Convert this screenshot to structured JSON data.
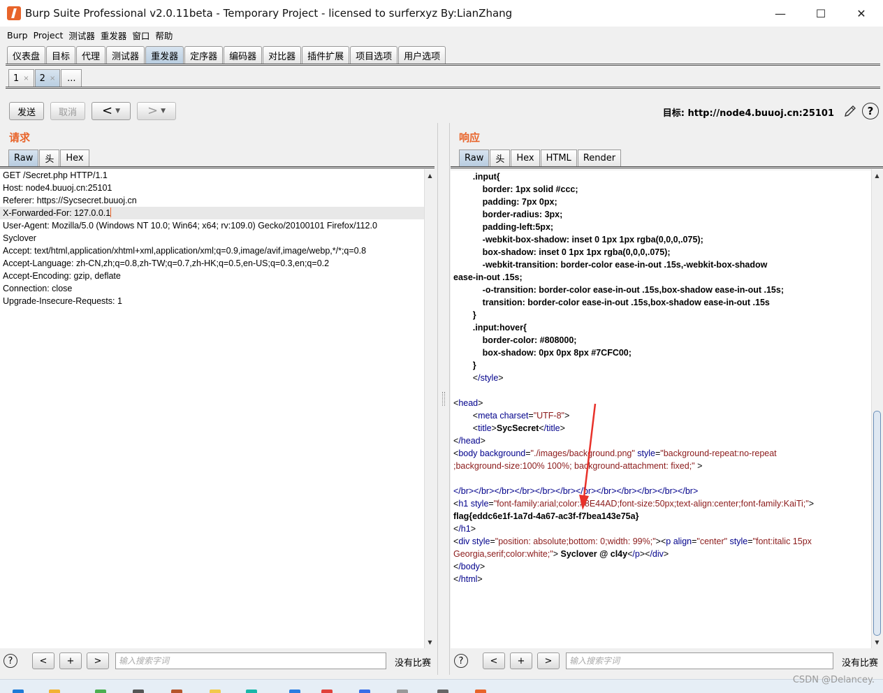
{
  "window": {
    "title": "Burp Suite Professional v2.0.11beta - Temporary Project - licensed to surferxyz By:LianZhang",
    "minimize": "—",
    "maximize": "☐",
    "close": "✕"
  },
  "menu": [
    "Burp",
    "Project",
    "测试器",
    "重发器",
    "窗口",
    "帮助"
  ],
  "main_tabs": [
    {
      "label": "仪表盘",
      "active": false
    },
    {
      "label": "目标",
      "active": false
    },
    {
      "label": "代理",
      "active": false
    },
    {
      "label": "测试器",
      "active": false
    },
    {
      "label": "重发器",
      "active": true
    },
    {
      "label": "定序器",
      "active": false
    },
    {
      "label": "编码器",
      "active": false
    },
    {
      "label": "对比器",
      "active": false
    },
    {
      "label": "插件扩展",
      "active": false
    },
    {
      "label": "项目选项",
      "active": false
    },
    {
      "label": "用户选项",
      "active": false
    }
  ],
  "repeater_tabs": {
    "tab1": "1",
    "tab2": "2",
    "close": "×",
    "more": "..."
  },
  "toolbar": {
    "send": "发送",
    "cancel": "取消",
    "back": "<",
    "forward": ">",
    "dropdown": "▼",
    "target_label": "目标: http://node4.buuoj.cn:25101"
  },
  "request": {
    "title": "请求",
    "tabs": [
      "Raw",
      "头",
      "Hex"
    ],
    "lines": [
      "GET /Secret.php HTTP/1.1",
      "Host: node4.buuoj.cn:25101",
      "Referer: https://Sycsecret.buuoj.cn",
      "X-Forwarded-For: 127.0.0.1",
      "User-Agent: Mozilla/5.0 (Windows NT 10.0; Win64; x64; rv:109.0) Gecko/20100101 Firefox/112.0",
      "Syclover",
      "Accept: text/html,application/xhtml+xml,application/xml;q=0.9,image/avif,image/webp,*/*;q=0.8",
      "Accept-Language: zh-CN,zh;q=0.8,zh-TW;q=0.7,zh-HK;q=0.5,en-US;q=0.3,en;q=0.2",
      "Accept-Encoding: gzip, deflate",
      "Connection: close",
      "Upgrade-Insecure-Requests: 1"
    ]
  },
  "response": {
    "title": "响应",
    "tabs": [
      "Raw",
      "头",
      "Hex",
      "HTML",
      "Render"
    ],
    "css_lines": [
      "        .input{",
      "            border: 1px solid #ccc;",
      "            padding: 7px 0px;",
      "            border-radius: 3px;",
      "            padding-left:5px;",
      "            -webkit-box-shadow: inset 0 1px 1px rgba(0,0,0,.075);",
      "            box-shadow: inset 0 1px 1px rgba(0,0,0,.075);",
      "            -webkit-transition: border-color ease-in-out .15s,-webkit-box-shadow",
      "ease-in-out .15s;",
      "            -o-transition: border-color ease-in-out .15s,box-shadow ease-in-out .15s;",
      "            transition: border-color ease-in-out .15s,box-shadow ease-in-out .15s",
      "        }",
      "        .input:hover{",
      "            border-color: #808000;",
      "            box-shadow: 0px 0px 8px #7CFC00;",
      "        }"
    ],
    "close_style": "/style",
    "head_tag": "head",
    "head_close": "/head",
    "meta": {
      "tag": "meta",
      "attr": "charset",
      "val": "\"UTF-8\""
    },
    "title_tag": "title",
    "title_text": "SycSecret",
    "title_close": "/title",
    "body_tag": "body",
    "body_attr1": "background",
    "body_val1": "\"./images/background.png\"",
    "body_attr2": "style",
    "body_val2a": "\"background-repeat:no-repeat",
    "body_val2b": ";background-size:100% 100%; background-attachment: fixed;\"",
    "br_line": "</br></br></br></br></br></br></br></br></br></br></br></br>",
    "h1_tag": "h1",
    "h1_attr": "style",
    "h1_val": "\"font-family:arial;color:#8E44AD;font-size:50px;text-align:center;font-family:KaiTi;\"",
    "flag": "flag{eddc6e1f-1a7d-4a67-ac3f-f7bea143e75a}",
    "h1_close": "/h1",
    "div_tag": "div",
    "div_attr": "style",
    "div_val": "\"position: absolute;bottom: 0;width: 99%;\"",
    "p_tag": "p",
    "p_attr1": "align",
    "p_val1": "\"center\"",
    "p_attr2": "style",
    "p_val2a": "\"font:italic 15px",
    "p_val2b": "Georgia,serif;color:white;\"",
    "p_text": " Syclover @ cl4y",
    "p_close": "/p",
    "div_close": "/div",
    "body_close": "/body",
    "html_close": "/html"
  },
  "search": {
    "help": "?",
    "prev": "<",
    "add": "+",
    "next": ">",
    "placeholder": "输入搜索字词",
    "no_match": "没有比赛"
  },
  "watermark": "CSDN @Delancey.",
  "colors": {
    "accent": "#e8642a",
    "tag": "#00008b",
    "attr_value": "#8b1a1a",
    "arrow": "#e8312a"
  }
}
